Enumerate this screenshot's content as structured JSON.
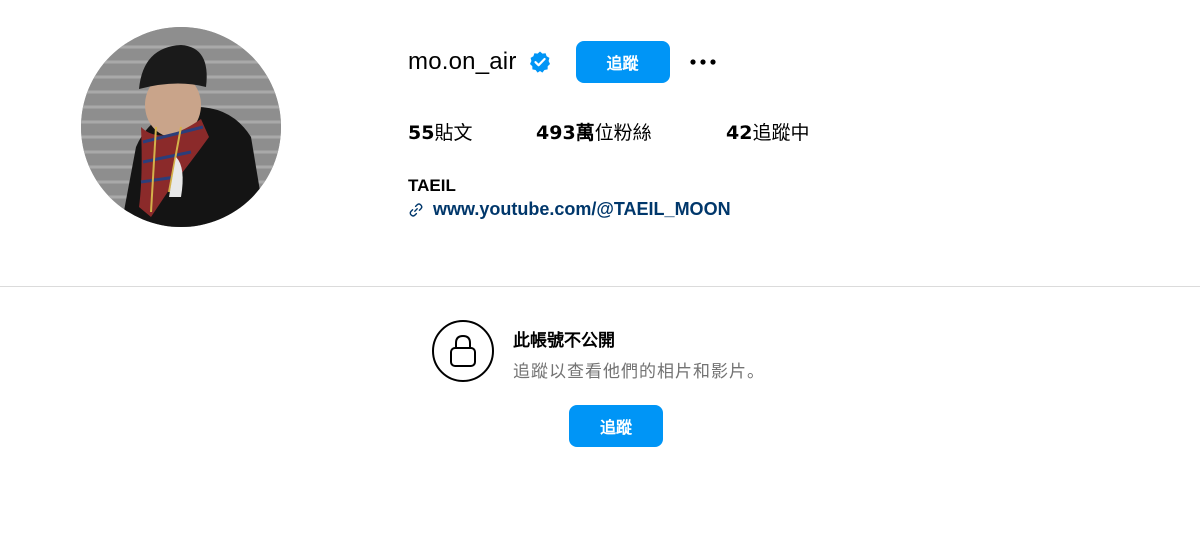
{
  "profile": {
    "username": "mo.on_air",
    "follow_label": "追蹤",
    "stats": {
      "posts_count": "55",
      "posts_label": "貼文",
      "followers_count": "493萬",
      "followers_label": "位粉絲",
      "following_count": "42",
      "following_label": "追蹤中"
    },
    "bio_name": "TAEIL",
    "bio_link": "www.youtube.com/@TAEIL_MOON"
  },
  "private_notice": {
    "title": "此帳號不公開",
    "subtitle": "追蹤以查看他們的相片和影片。",
    "follow_label": "追蹤"
  },
  "icons": {
    "verified": "verified-badge-icon",
    "more": "more-options-icon",
    "link": "link-icon",
    "lock": "lock-icon"
  },
  "colors": {
    "accent": "#0095f6",
    "link": "#00376b",
    "muted": "#737373",
    "divider": "#dbdbdb"
  }
}
